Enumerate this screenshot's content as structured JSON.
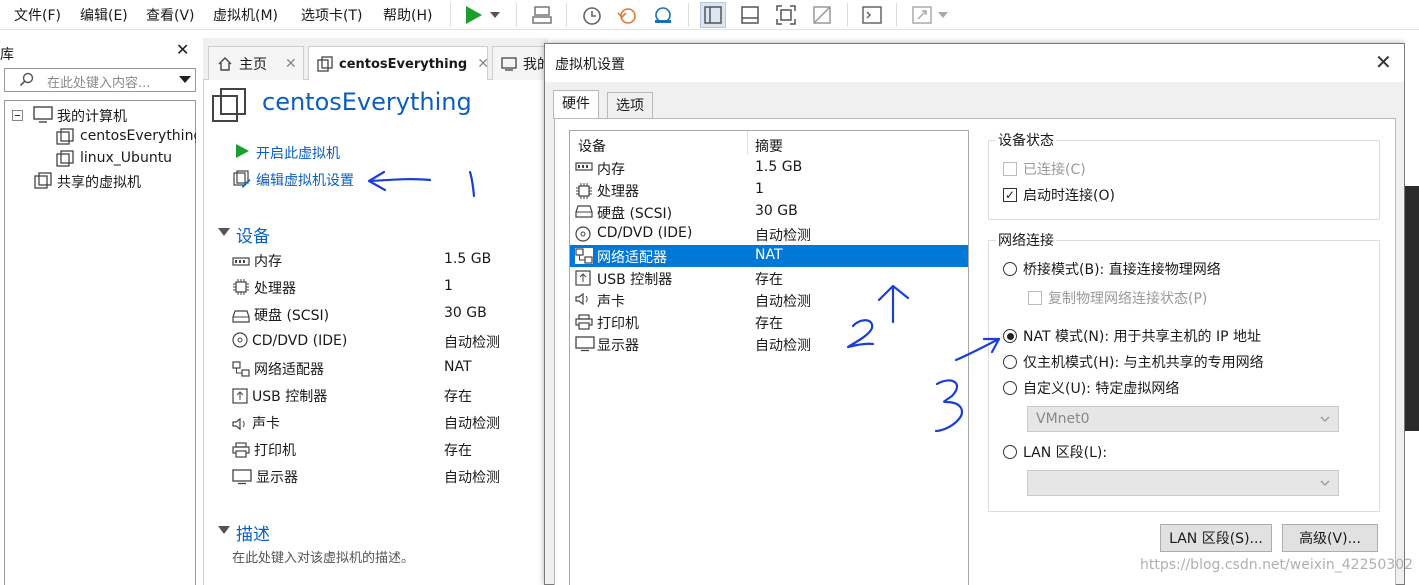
{
  "menubar": {
    "items": [
      "文件(F)",
      "编辑(E)",
      "查看(V)",
      "虚拟机(M)",
      "选项卡(T)",
      "帮助(H)"
    ]
  },
  "toolbar": {
    "icons": [
      "play-icon",
      "dropdown-icon",
      "send-keys-icon",
      "snapshot-icon",
      "revert-snapshot-icon",
      "snapshot-manager-icon",
      "sidebar-view-icon",
      "thumbnail-view-icon",
      "fullscreen-icon",
      "unity-icon",
      "console-icon",
      "stretch-icon"
    ]
  },
  "library": {
    "title": "库",
    "search_placeholder": "在此处键入内容...",
    "tree": {
      "root": "我的计算机",
      "vms": [
        "centosEverything",
        "linux_Ubuntu"
      ],
      "shared": "共享的虚拟机"
    }
  },
  "tabs": {
    "home": "主页",
    "active": "centosEverything",
    "partial": "我的"
  },
  "vm": {
    "name": "centosEverything",
    "actions": {
      "start": "开启此虚拟机",
      "edit": "编辑虚拟机设置"
    },
    "devices_heading": "设备",
    "devices": [
      {
        "icon": "memory-icon",
        "name": "内存",
        "value": "1.5 GB"
      },
      {
        "icon": "processor-icon",
        "name": "处理器",
        "value": "1"
      },
      {
        "icon": "harddisk-icon",
        "name": "硬盘 (SCSI)",
        "value": "30 GB"
      },
      {
        "icon": "cdrom-icon",
        "name": "CD/DVD (IDE)",
        "value": "自动检测"
      },
      {
        "icon": "network-icon",
        "name": "网络适配器",
        "value": "NAT"
      },
      {
        "icon": "usb-icon",
        "name": "USB 控制器",
        "value": "存在"
      },
      {
        "icon": "sound-icon",
        "name": "声卡",
        "value": "自动检测"
      },
      {
        "icon": "printer-icon",
        "name": "打印机",
        "value": "存在"
      },
      {
        "icon": "display-icon",
        "name": "显示器",
        "value": "自动检测"
      }
    ],
    "description_heading": "描述",
    "description_placeholder": "在此处键入对该虚拟机的描述。"
  },
  "dialog": {
    "title": "虚拟机设置",
    "tabs": [
      "硬件",
      "选项"
    ],
    "list_headers": {
      "device": "设备",
      "summary": "摘要"
    },
    "selected_index": 4,
    "device_status": {
      "title": "设备状态",
      "connected": "已连接(C)",
      "connect_at_power_on": "启动时连接(O)"
    },
    "network": {
      "title": "网络连接",
      "bridged": "桥接模式(B): 直接连接物理网络",
      "replicate": "复制物理网络连接状态(P)",
      "nat": "NAT 模式(N): 用于共享主机的 IP 地址",
      "host_only": "仅主机模式(H): 与主机共享的专用网络",
      "custom": "自定义(U): 特定虚拟网络",
      "custom_value": "VMnet0",
      "lan": "LAN 区段(L):",
      "lan_value": "",
      "selected": "nat"
    },
    "buttons": {
      "lan_segments": "LAN 区段(S)...",
      "advanced": "高级(V)..."
    }
  },
  "annotations": {
    "one": "1",
    "two": "2",
    "three": "3"
  },
  "watermark": "https://blog.csdn.net/weixin_42250302",
  "colors": {
    "accent": "#0078d7",
    "link": "#0b5fbf",
    "play": "#1a9e2e",
    "ink": "#1a3fd6"
  }
}
